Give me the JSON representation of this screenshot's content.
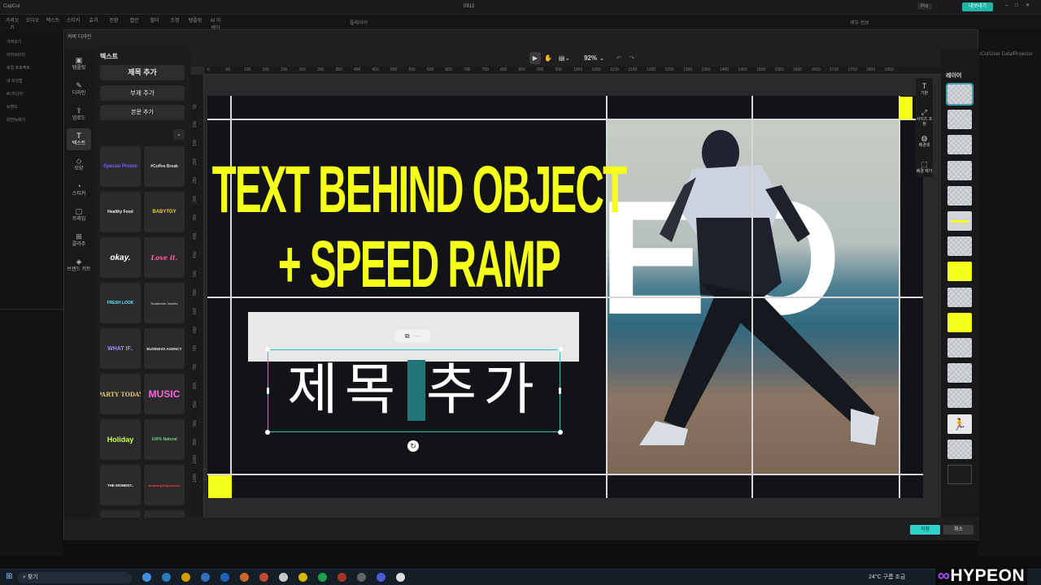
{
  "app": {
    "window_title": "0912",
    "logo": "CapCut",
    "tools": [
      "가져오기",
      "오디오",
      "텍스트",
      "스티커",
      "효과",
      "전환",
      "캡션",
      "필터",
      "조정",
      "템플릿",
      "AI 아바타"
    ],
    "side_items": [
      "가져오기",
      "라이브러리",
      "로컬 프로젝트",
      "내 보관함",
      "AI 미디어",
      "브랜드",
      "화면녹화기"
    ],
    "pro_badge": "Pro",
    "export_label": "내보내기",
    "player_label": "플레이어",
    "details_label": "세부 정보",
    "path_text": "pCut/User Data/Projects/"
  },
  "dialog": {
    "title": "커버 디자인",
    "nav": [
      {
        "label": "템플릿",
        "icon": "▣"
      },
      {
        "label": "디자인",
        "icon": "✎"
      },
      {
        "label": "업로드",
        "icon": "⇪"
      },
      {
        "label": "텍스트",
        "icon": "T"
      },
      {
        "label": "모양",
        "icon": "◇"
      },
      {
        "label": "스티커",
        "icon": "◔"
      },
      {
        "label": "프레임",
        "icon": "▢"
      },
      {
        "label": "콜라주",
        "icon": "⊞"
      },
      {
        "label": "브랜드 키트",
        "icon": "◈"
      }
    ],
    "confirm_label": "저장",
    "cancel_label": "취소"
  },
  "text_panel": {
    "heading": "텍스트",
    "add_title": "제목 추가",
    "add_subtitle": "부제 추가",
    "add_body": "본문 추가",
    "presets": [
      {
        "label": "Special Promo",
        "color": "#7b5cff"
      },
      {
        "label": "#Coffee Break",
        "color": "#dddddd"
      },
      {
        "label": "Healthy Food",
        "color": "#f0f0f0"
      },
      {
        "label": "BABYTOY",
        "color": "#f6c928"
      },
      {
        "label": "okay.",
        "color": "#ffffff"
      },
      {
        "label": "Love it.",
        "color": "#ff5fa2"
      },
      {
        "label": "FRESH LOOK",
        "color": "#5fe3ff"
      },
      {
        "label": "Sunkissle Jewels",
        "color": "#b9b9b9"
      },
      {
        "label": "WHAT IF..",
        "color": "#9d8cff"
      },
      {
        "label": "BUSINESS AGENCY",
        "color": "#e8e8e8"
      },
      {
        "label": "PARTY TODAY",
        "color": "#e6c46a"
      },
      {
        "label": "MUSIC",
        "color": "#ff63d7"
      },
      {
        "label": "Holiday",
        "color": "#c6ff4a"
      },
      {
        "label": "100% Natural",
        "color": "#6dd17a"
      },
      {
        "label": "THE MOMENT..",
        "color": "#f0f0f0"
      },
      {
        "label": "Amazing Experience",
        "color": "#ff3b3b"
      }
    ]
  },
  "canvas": {
    "zoom": "92%",
    "ruler_ticks": [
      "0",
      "50",
      "100",
      "150",
      "200",
      "250",
      "300",
      "350",
      "400",
      "450",
      "500",
      "550",
      "600",
      "650",
      "700",
      "750",
      "800",
      "850",
      "900",
      "950",
      "1000",
      "1050",
      "1100",
      "1150",
      "1200",
      "1250",
      "1300",
      "1350",
      "1400",
      "1450",
      "1500",
      "1550",
      "1600",
      "1650",
      "1700",
      "1750",
      "1800",
      "1850"
    ],
    "ruler_left_ticks": [
      "50",
      "100",
      "150",
      "200",
      "250",
      "300",
      "350",
      "400",
      "450",
      "500",
      "550",
      "600",
      "650",
      "700",
      "750",
      "800",
      "850",
      "900",
      "950",
      "1000",
      "1050"
    ],
    "headline_line1": "TEXT BEHIND OBJECT",
    "headline_line2": "+ SPEED RAMP",
    "background_letters": "EO",
    "editing_text": "제목 추가",
    "side_tools": [
      {
        "label": "기본",
        "icon": "T"
      },
      {
        "label": "사이즈 조정",
        "icon": "⤢"
      },
      {
        "label": "배경색",
        "icon": "◍"
      },
      {
        "label": "배경 제거",
        "icon": "⬚"
      }
    ],
    "accent": "#f4ff1a",
    "selection_color": "#29c2bf"
  },
  "layers": {
    "title": "레이어",
    "count": 16
  },
  "taskbar": {
    "search_placeholder": "찾기",
    "weather": "24°C 구름 조금",
    "brand": "HYPEON",
    "brand_symbol": "∞"
  }
}
